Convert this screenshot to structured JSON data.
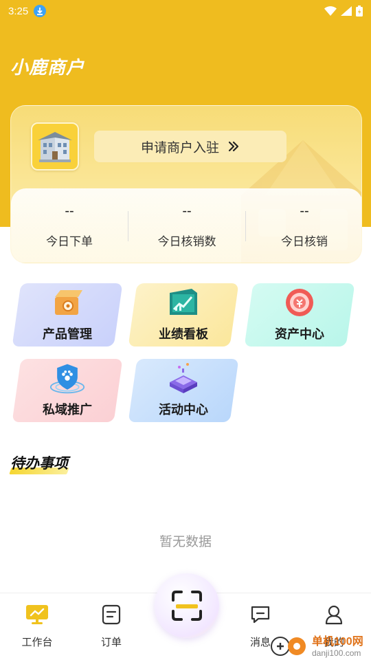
{
  "status_bar": {
    "time": "3:25"
  },
  "app_title": "小鹿商户",
  "merchant": {
    "apply_label": "申请商户入驻",
    "stats": [
      {
        "value": "--",
        "label": "今日下单"
      },
      {
        "value": "--",
        "label": "今日核销数"
      },
      {
        "value": "--",
        "label": "今日核销"
      }
    ]
  },
  "menu": [
    {
      "label": "产品管理",
      "icon": "product-box-icon"
    },
    {
      "label": "业绩看板",
      "icon": "performance-board-icon"
    },
    {
      "label": "资产中心",
      "icon": "asset-coin-icon"
    },
    {
      "label": "私域推广",
      "icon": "private-domain-shield-icon"
    },
    {
      "label": "活动中心",
      "icon": "activity-stage-icon"
    }
  ],
  "todo": {
    "title": "待办事项",
    "empty_text": "暂无数据"
  },
  "tabs": [
    {
      "label": "工作台",
      "icon": "workbench-icon"
    },
    {
      "label": "订单",
      "icon": "order-icon"
    },
    {
      "label": "消息",
      "icon": "message-icon"
    },
    {
      "label": "我的",
      "icon": "profile-icon"
    }
  ],
  "watermark": {
    "title": "单机100网",
    "url": "danji100.com"
  },
  "colors": {
    "brand_yellow": "#efbc1f",
    "active_tab": "#f0c21e"
  }
}
